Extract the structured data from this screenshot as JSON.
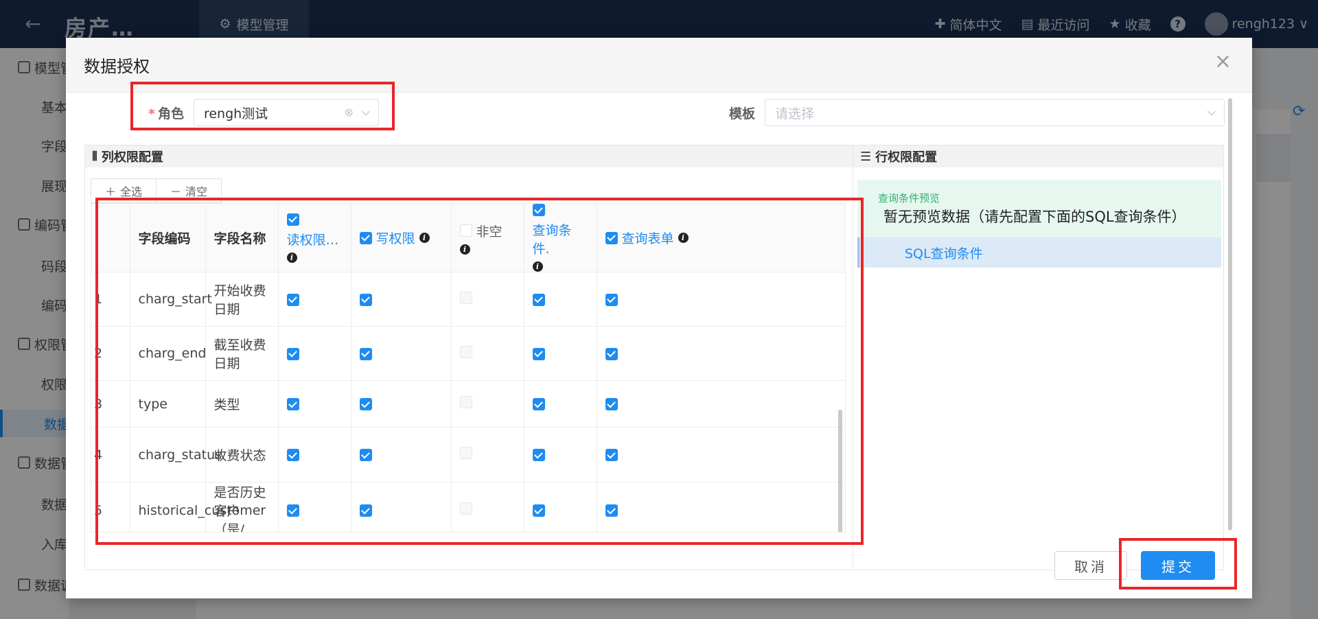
{
  "topbar": {
    "back_icon": "arrow-left-icon",
    "app_title": "房产…",
    "module_tab": "模型管理",
    "language": "简体中文",
    "recent": "最近访问",
    "favorites": "收藏",
    "help": "?",
    "username": "rengh123",
    "dropdown": "∨"
  },
  "sidebar": {
    "items": [
      {
        "label": "模型管理",
        "type": "group"
      },
      {
        "label": "基本信息",
        "type": "sub"
      },
      {
        "label": "字段管理",
        "type": "sub"
      },
      {
        "label": "展现配置",
        "type": "sub"
      },
      {
        "label": "编码管理",
        "type": "group"
      },
      {
        "label": "码段",
        "type": "sub"
      },
      {
        "label": "编码",
        "type": "sub"
      },
      {
        "label": "权限管理",
        "type": "group"
      },
      {
        "label": "权限",
        "type": "sub"
      },
      {
        "label": "数据授权",
        "type": "sub",
        "active": true
      },
      {
        "label": "数据管理",
        "type": "group"
      },
      {
        "label": "数据",
        "type": "sub"
      },
      {
        "label": "入库",
        "type": "sub"
      },
      {
        "label": "数据调用",
        "type": "group"
      }
    ]
  },
  "dialog": {
    "title": "数据授权",
    "close": "×",
    "role_label": "角色",
    "required_mark": "*",
    "role_value": "rengh测试",
    "template_label": "模板",
    "template_placeholder": "请选择",
    "column_panel_title": "列权限配置",
    "select_all": "全选",
    "clear": "清空",
    "row_panel_title": "行权限配置",
    "preview_label": "查询条件预览",
    "preview_text": "暂无预览数据（请先配置下面的SQL查询条件）",
    "sql_condition": "SQL查询条件",
    "cancel": "取消",
    "submit": "提交"
  },
  "table": {
    "headers": {
      "field_code": "字段编码",
      "field_name": "字段名称",
      "read": "读权限…",
      "write": "写权限",
      "not_null": "非空",
      "query_cond": "查询条件.",
      "query_form": "查询表单"
    },
    "rows": [
      {
        "idx": "1",
        "code": "charg_start",
        "name": "开始收费日期",
        "read": true,
        "write": true,
        "not_null": false,
        "query_cond": true,
        "query_form": true
      },
      {
        "idx": "2",
        "code": "charg_end",
        "name": "截至收费日期",
        "read": true,
        "write": true,
        "not_null": false,
        "query_cond": true,
        "query_form": true
      },
      {
        "idx": "3",
        "code": "type",
        "name": "类型",
        "read": true,
        "write": true,
        "not_null": false,
        "query_cond": true,
        "query_form": true
      },
      {
        "idx": "4",
        "code": "charg_status",
        "name": "收费状态",
        "read": true,
        "write": true,
        "not_null": false,
        "query_cond": true,
        "query_form": true
      },
      {
        "idx": "5",
        "code": "historical_customer",
        "name": "是否历史客户（是/",
        "read": true,
        "write": true,
        "not_null": false,
        "query_cond": true,
        "query_form": true
      }
    ]
  },
  "colors": {
    "accent": "#1e8cf0",
    "highlight_box": "#e8262a",
    "topbar": "#1b3153",
    "preview_bg": "#e6f7ef"
  }
}
